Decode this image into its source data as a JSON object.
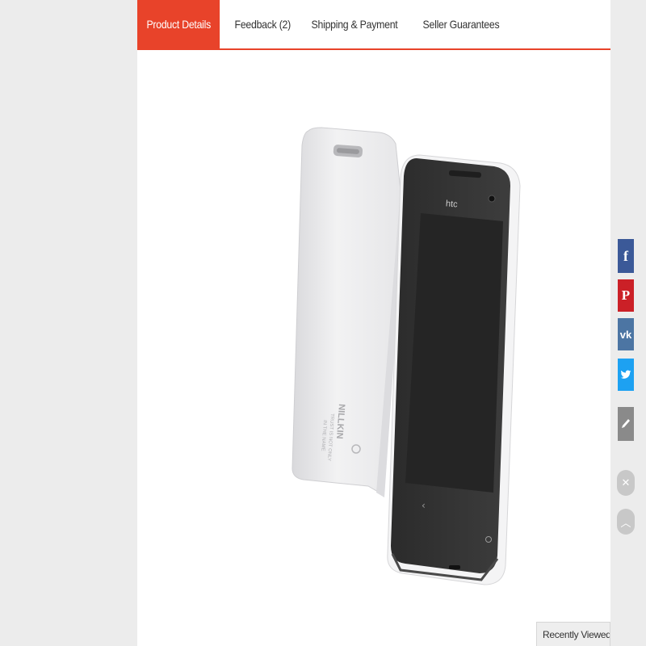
{
  "tabs": [
    {
      "label": "Product Details",
      "active": true
    },
    {
      "label": "Feedback (2)"
    },
    {
      "label": "Shipping & Payment"
    },
    {
      "label": "Seller Guarantees"
    }
  ],
  "product": {
    "phone_brand": "htc",
    "case_brand": "NILLKIN",
    "case_text_line1": "TRUST IS NOT ONLY",
    "case_text_line2": "IN THE NAME"
  },
  "share": [
    {
      "icon": "facebook-icon",
      "color": "#3b5998"
    },
    {
      "icon": "pinterest-icon",
      "color": "#cb2027"
    },
    {
      "icon": "vk-icon",
      "color": "#4c75a3"
    },
    {
      "icon": "twitter-icon",
      "color": "#1da1f2"
    },
    {
      "icon": "edit-icon",
      "color": "#8a8a8a"
    }
  ],
  "recently_viewed": {
    "label": "Recently Viewed"
  },
  "colors": {
    "accent": "#e8432a"
  }
}
